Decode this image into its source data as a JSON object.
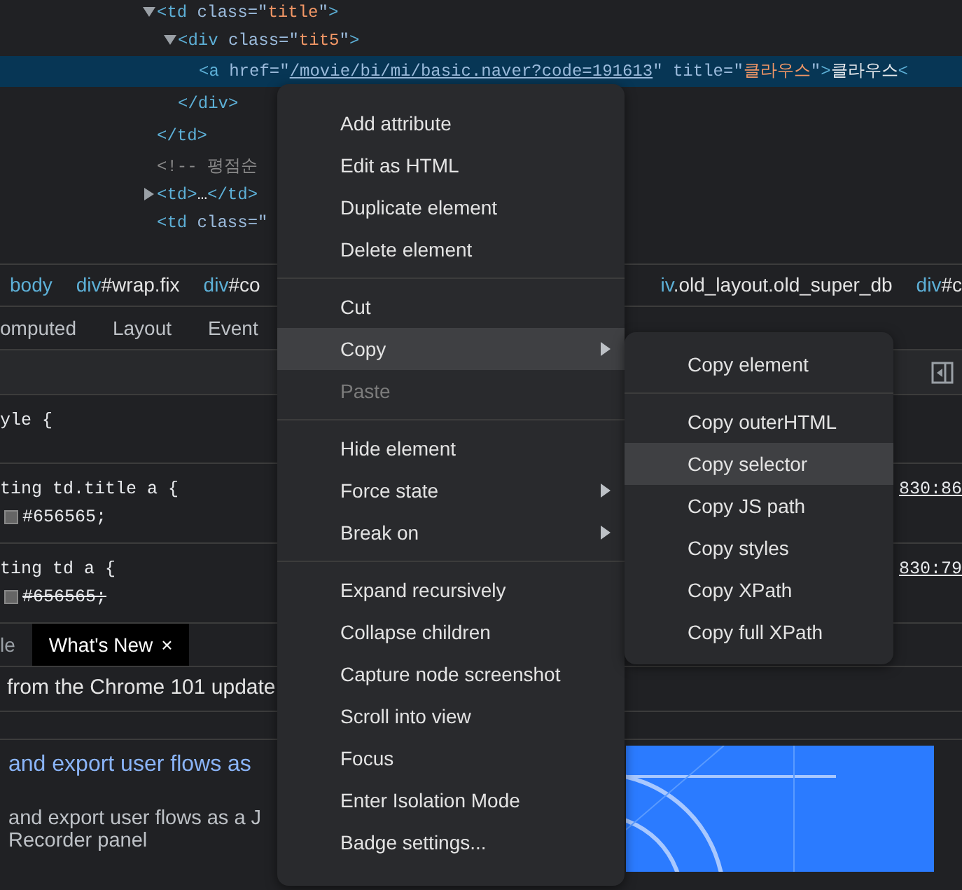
{
  "dom_tree": [
    {
      "segments": [
        {
          "kind": "tag",
          "text": "<td"
        },
        {
          "kind": "attr",
          "text": " class=\""
        },
        {
          "kind": "value",
          "text": "title"
        },
        {
          "kind": "attr",
          "text": "\""
        },
        {
          "kind": "tag",
          "text": ">"
        }
      ],
      "expanded": true,
      "selected": false,
      "closing": [
        {
          "kind": "tag",
          "text": "</td>"
        }
      ],
      "children": [
        {
          "segments": [
            {
              "kind": "tag",
              "text": "<div"
            },
            {
              "kind": "attr",
              "text": " class=\""
            },
            {
              "kind": "value",
              "text": "tit5"
            },
            {
              "kind": "attr",
              "text": "\""
            },
            {
              "kind": "tag",
              "text": ">"
            }
          ],
          "expanded": true,
          "selected": false,
          "closing": [
            {
              "kind": "tag",
              "text": "</div>"
            }
          ],
          "children": [
            {
              "segments": [
                {
                  "kind": "tag",
                  "text": "<a"
                },
                {
                  "kind": "attr",
                  "text": " href=\""
                },
                {
                  "kind": "link",
                  "text": "/movie/bi/mi/basic.naver?code=191613"
                },
                {
                  "kind": "attr",
                  "text": "\" title=\""
                },
                {
                  "kind": "value",
                  "text": "클라우스"
                },
                {
                  "kind": "attr",
                  "text": "\""
                },
                {
                  "kind": "tag",
                  "text": ">"
                },
                {
                  "kind": "text",
                  "text": "클라우스"
                },
                {
                  "kind": "tag",
                  "text": "<"
                }
              ],
              "selected": true
            }
          ]
        }
      ]
    },
    {
      "segments": [
        {
          "kind": "comment",
          "text": "<!-- 평점순"
        }
      ],
      "selected": false
    },
    {
      "segments": [
        {
          "kind": "tag",
          "text": "<td>"
        },
        {
          "kind": "text",
          "text": "…"
        },
        {
          "kind": "tag",
          "text": "</td>"
        }
      ],
      "expanded": false,
      "selected": false
    },
    {
      "segments": [
        {
          "kind": "tag",
          "text": "<td"
        },
        {
          "kind": "attr",
          "text": " class=\""
        }
      ],
      "selected": false
    }
  ],
  "breadcrumbs_left": [
    {
      "tag": "body"
    },
    {
      "tag": "div",
      "rest": "#wrap.fix"
    },
    {
      "tag": "div",
      "rest": "#co"
    }
  ],
  "breadcrumbs_right": [
    {
      "tag": "iv",
      "rest": ".old_layout.old_super_db"
    },
    {
      "tag": "div",
      "rest": "#c"
    }
  ],
  "sidebar_tabs": [
    "omputed",
    "Layout",
    "Event"
  ],
  "style_rules": [
    {
      "selector": "yle {"
    },
    {
      "selector": "ting td.title a {",
      "value": "#656565;",
      "overridden": false,
      "source": "830:86"
    },
    {
      "selector": "ting td a {",
      "value": "#656565;",
      "overridden": true,
      "source": "830:79"
    }
  ],
  "drawer_tabs": [
    {
      "label": "le",
      "selected": false
    },
    {
      "label": "What's New",
      "selected": true,
      "close": "×"
    }
  ],
  "whats_new": {
    "header": "from the Chrome 101 update",
    "link": "and export user flows as",
    "lines": [
      "and export user flows as a J",
      "Recorder panel"
    ]
  },
  "context_menu": [
    {
      "kind": "item",
      "label": "Add attribute",
      "selected": false,
      "disabled": false,
      "submenu": false
    },
    {
      "kind": "item",
      "label": "Edit as HTML",
      "selected": false,
      "disabled": false,
      "submenu": false
    },
    {
      "kind": "item",
      "label": "Duplicate element",
      "selected": false,
      "disabled": false,
      "submenu": false
    },
    {
      "kind": "item",
      "label": "Delete element",
      "selected": false,
      "disabled": false,
      "submenu": false
    },
    {
      "kind": "separator"
    },
    {
      "kind": "item",
      "label": "Cut",
      "selected": false,
      "disabled": false,
      "submenu": false
    },
    {
      "kind": "item",
      "label": "Copy",
      "selected": true,
      "disabled": false,
      "submenu": true
    },
    {
      "kind": "item",
      "label": "Paste",
      "selected": false,
      "disabled": true,
      "submenu": false
    },
    {
      "kind": "separator"
    },
    {
      "kind": "item",
      "label": "Hide element",
      "selected": false,
      "disabled": false,
      "submenu": false
    },
    {
      "kind": "item",
      "label": "Force state",
      "selected": false,
      "disabled": false,
      "submenu": true
    },
    {
      "kind": "item",
      "label": "Break on",
      "selected": false,
      "disabled": false,
      "submenu": true
    },
    {
      "kind": "separator"
    },
    {
      "kind": "item",
      "label": "Expand recursively",
      "selected": false,
      "disabled": false,
      "submenu": false
    },
    {
      "kind": "item",
      "label": "Collapse children",
      "selected": false,
      "disabled": false,
      "submenu": false
    },
    {
      "kind": "item",
      "label": "Capture node screenshot",
      "selected": false,
      "disabled": false,
      "submenu": false
    },
    {
      "kind": "item",
      "label": "Scroll into view",
      "selected": false,
      "disabled": false,
      "submenu": false
    },
    {
      "kind": "item",
      "label": "Focus",
      "selected": false,
      "disabled": false,
      "submenu": false
    },
    {
      "kind": "item",
      "label": "Enter Isolation Mode",
      "selected": false,
      "disabled": false,
      "submenu": false
    },
    {
      "kind": "item",
      "label": "Badge settings...",
      "selected": false,
      "disabled": false,
      "submenu": false
    }
  ],
  "copy_submenu": [
    {
      "kind": "item",
      "label": "Copy element",
      "selected": false
    },
    {
      "kind": "separator"
    },
    {
      "kind": "item",
      "label": "Copy outerHTML",
      "selected": false
    },
    {
      "kind": "item",
      "label": "Copy selector",
      "selected": true
    },
    {
      "kind": "item",
      "label": "Copy JS path",
      "selected": false
    },
    {
      "kind": "item",
      "label": "Copy styles",
      "selected": false
    },
    {
      "kind": "item",
      "label": "Copy XPath",
      "selected": false
    },
    {
      "kind": "item",
      "label": "Copy full XPath",
      "selected": false
    }
  ]
}
